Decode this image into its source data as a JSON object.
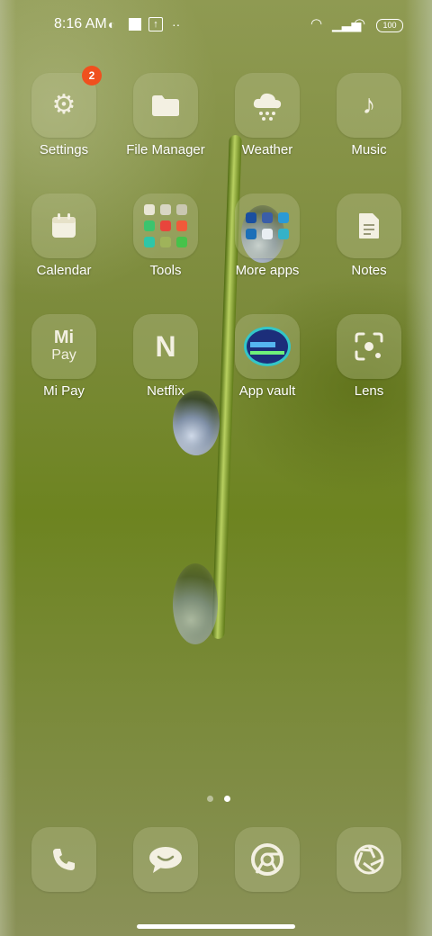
{
  "status_bar": {
    "time": "8:16 AM",
    "battery": "100",
    "icons": [
      "data-saver-icon",
      "square-icon",
      "upload-icon",
      "more-dots-icon",
      "hotspot-icon",
      "signal-icon",
      "wifi-icon",
      "battery-icon"
    ]
  },
  "apps": [
    {
      "label": "Settings",
      "icon": "gear-icon",
      "badge": "2"
    },
    {
      "label": "File Manager",
      "icon": "folder-icon"
    },
    {
      "label": "Weather",
      "icon": "cloud-snow-icon"
    },
    {
      "label": "Music",
      "icon": "music-note-icon"
    },
    {
      "label": "Calendar",
      "icon": "calendar-icon"
    },
    {
      "label": "Tools",
      "icon": "folder-tools-icon"
    },
    {
      "label": "More apps",
      "icon": "folder-more-apps-icon"
    },
    {
      "label": "Notes",
      "icon": "note-icon"
    },
    {
      "label": "Mi Pay",
      "icon": "mi-pay-icon",
      "icon_text_top": "Mi",
      "icon_text_bottom": "Pay"
    },
    {
      "label": "Netflix",
      "icon": "netflix-icon",
      "icon_text": "N"
    },
    {
      "label": "App vault",
      "icon": "app-vault-icon"
    },
    {
      "label": "Lens",
      "icon": "lens-icon"
    }
  ],
  "page_indicator": {
    "pages": 2,
    "active": 2
  },
  "dock": [
    {
      "icon": "phone-icon"
    },
    {
      "icon": "messaging-icon"
    },
    {
      "icon": "chrome-icon"
    },
    {
      "icon": "camera-icon"
    }
  ],
  "colors": {
    "badge": "#f0501e",
    "icon_tint": "#f3f0e2",
    "vault_blue": "#1c2e7a"
  }
}
